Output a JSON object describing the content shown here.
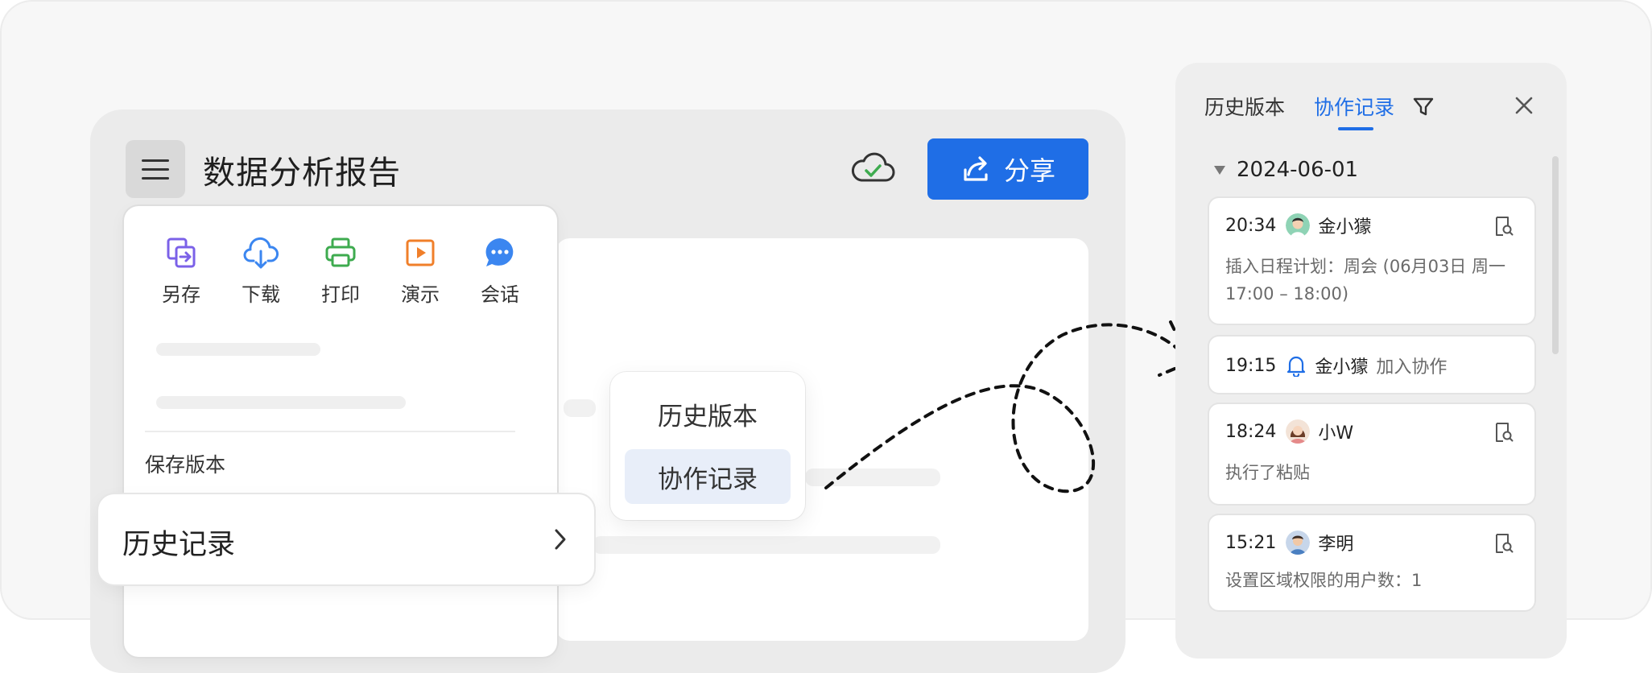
{
  "document": {
    "title": "数据分析报告",
    "share_label": "分享"
  },
  "menu": {
    "quick_actions": [
      {
        "label": "另存",
        "icon": "save-as-icon",
        "color": "#7b61e8"
      },
      {
        "label": "下载",
        "icon": "cloud-download-icon",
        "color": "#3b86f0"
      },
      {
        "label": "打印",
        "icon": "printer-icon",
        "color": "#3eab4f"
      },
      {
        "label": "演示",
        "icon": "present-icon",
        "color": "#f07f2a"
      },
      {
        "label": "会话",
        "icon": "chat-icon",
        "color": "#3b86f0"
      }
    ],
    "save_version": "保存版本",
    "history": "历史记录"
  },
  "popup": {
    "items": [
      "历史版本",
      "协作记录"
    ],
    "active": "协作记录"
  },
  "panel": {
    "tabs": [
      "历史版本",
      "协作记录"
    ],
    "active_tab": "协作记录",
    "date": "2024-06-01",
    "records": [
      {
        "time": "20:34",
        "user": "金小獴",
        "detail": "插入日程计划：周会 (06月03日 周一 17:00 – 18:00)"
      },
      {
        "time": "19:15",
        "user": "金小獴",
        "action": "加入协作"
      },
      {
        "time": "18:24",
        "user": "小W",
        "detail": "执行了粘贴"
      },
      {
        "time": "15:21",
        "user": "李明",
        "detail": "设置区域权限的用户数：1"
      }
    ]
  },
  "colors": {
    "accent": "#1f6ee6",
    "cloud_check": "#3eab4f"
  }
}
